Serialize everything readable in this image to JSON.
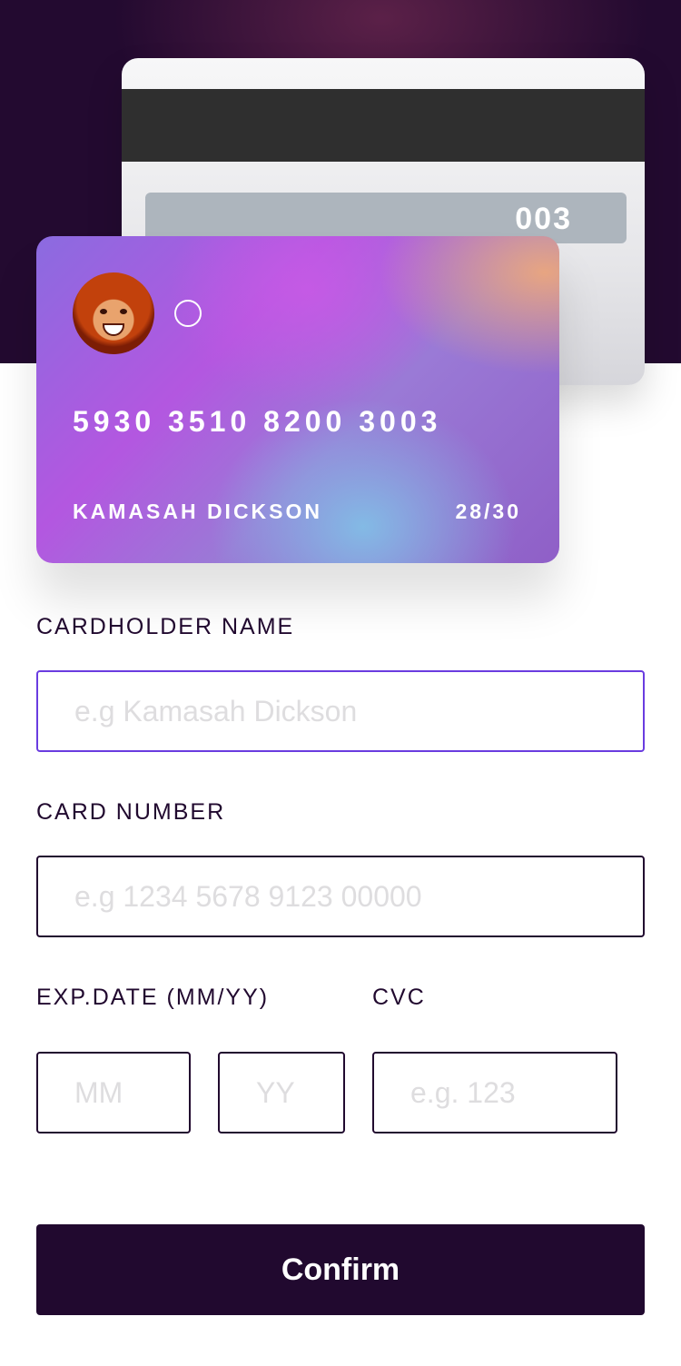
{
  "card": {
    "cvc": "003",
    "number": "5930 3510 8200 3003",
    "holder": "KAMASAH DICKSON",
    "expiry": "28/30"
  },
  "form": {
    "name_label": "CARDHOLDER NAME",
    "name_placeholder": "e.g Kamasah Dickson",
    "number_label": "CARD NUMBER",
    "number_placeholder": "e.g 1234 5678 9123 00000",
    "exp_label": "EXP.DATE (MM/YY)",
    "mm_placeholder": "MM",
    "yy_placeholder": "YY",
    "cvc_label": "CVC",
    "cvc_placeholder": "e.g. 123",
    "confirm_label": "Confirm"
  },
  "colors": {
    "dark": "#21092f",
    "active_border": "#6a3ce0",
    "placeholder": "#dedddf"
  },
  "icons": {
    "avatar": "user-avatar",
    "ring": "circle-outline-icon"
  }
}
